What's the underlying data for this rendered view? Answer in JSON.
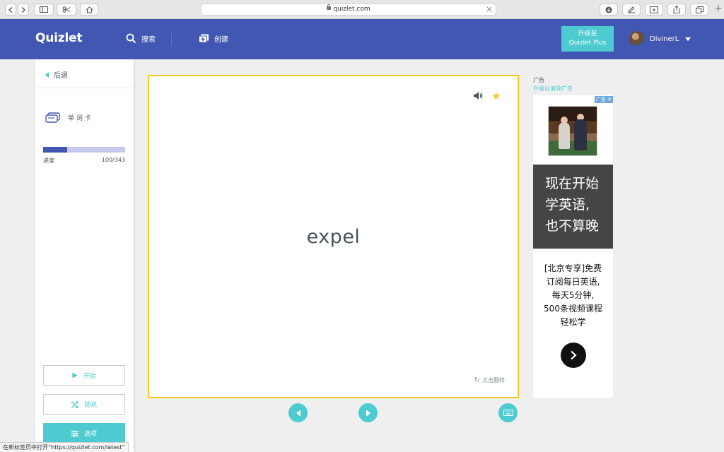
{
  "browser": {
    "url": "quizlet.com",
    "status_text": "在新标签页中打开“https://quizlet.com/latest”",
    "new_tab_label": "+"
  },
  "header": {
    "logo": "Quizlet",
    "search_label": "搜索",
    "create_label": "创建",
    "upgrade_line1": "升级至",
    "upgrade_line2": "Quizlet Plus",
    "username": "DivinerL"
  },
  "sidebar": {
    "back_label": "后退",
    "mode_label": "单 词 卡",
    "progress_label": "进度",
    "progress_count": "100/343",
    "progress_fraction": 0.2915,
    "start_label": "开始",
    "shuffle_label": "随机",
    "options_label": "选项"
  },
  "card": {
    "term": "expel",
    "flip_hint": "点击翻转",
    "starred": true
  },
  "ad": {
    "label": "广告",
    "remove_link": "升级以清除广告",
    "tag": "广告",
    "headline_1": "现在开始",
    "headline_2": "学英语,",
    "headline_3": "也不算晚",
    "body_1": "[北京专享]免费",
    "body_2": "订阅每日英语,",
    "body_3": "每天5分钟,",
    "body_4": "500条视频课程",
    "body_5": "轻松学"
  },
  "colors": {
    "brand": "#4257b2",
    "accent": "#4ecbd0",
    "card_border": "#f7c924"
  }
}
